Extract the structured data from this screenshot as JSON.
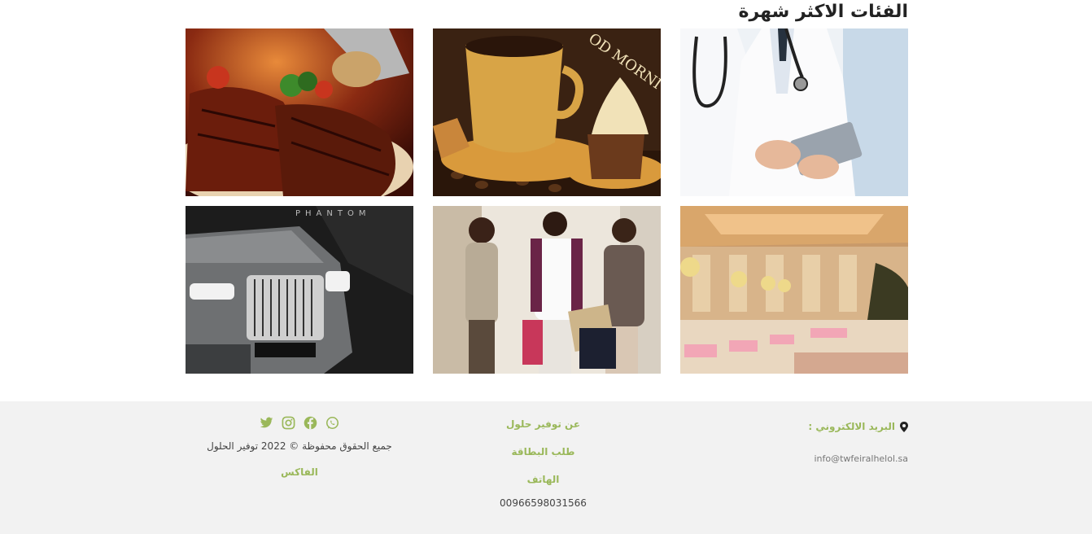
{
  "section": {
    "title": "الفئات الاكثر شهرة"
  },
  "categories": [
    {
      "id": "food",
      "image_text": ""
    },
    {
      "id": "coffee",
      "image_text": "OD MORNI"
    },
    {
      "id": "medical",
      "image_text": ""
    },
    {
      "id": "car",
      "image_text": "PHANTOM"
    },
    {
      "id": "shopping",
      "image_text": ""
    },
    {
      "id": "hall",
      "image_text": ""
    }
  ],
  "footer": {
    "contact": {
      "email_label": "البريد الالكتروني :",
      "email_value": "info@twfeiralhelol.sa"
    },
    "links": {
      "about": "عن توفير حلول",
      "card_request": "طلب البطاقة",
      "phone_label": "الهاتف",
      "phone_value": "00966598031566"
    },
    "social": {
      "copyright": "جميع الحقوق محفوظة © 2022 توفير الحلول",
      "fax_label": "الفاكس",
      "icons": [
        "whatsapp-icon",
        "facebook-icon",
        "instagram-icon",
        "twitter-icon"
      ]
    },
    "colors": {
      "accent": "#9ab85a",
      "background": "#f2f2f2"
    }
  }
}
